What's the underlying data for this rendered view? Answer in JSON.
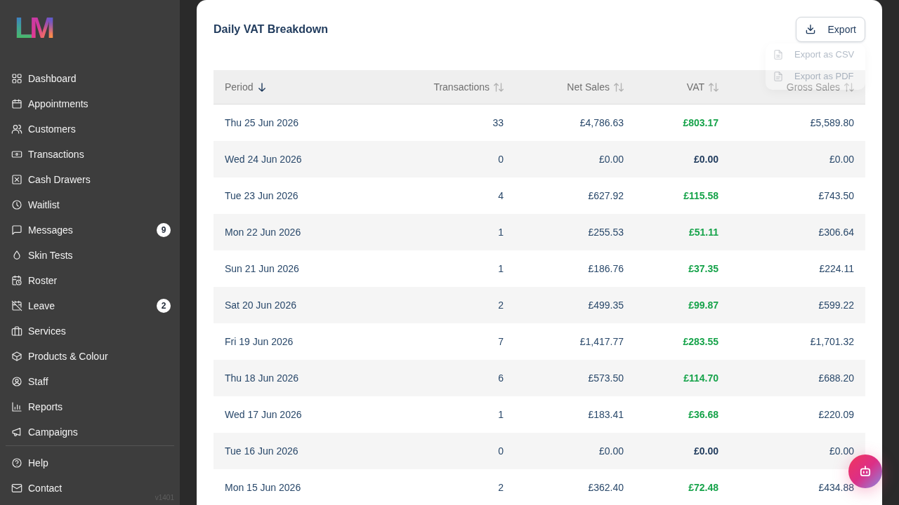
{
  "sidebar": {
    "logo_text": "LM",
    "nav_items": [
      {
        "label": "Dashboard",
        "selected": false
      },
      {
        "label": "Appointments",
        "selected": false
      },
      {
        "label": "Customers",
        "selected": false
      },
      {
        "label": "Transactions",
        "selected": false
      },
      {
        "label": "Cash Drawers",
        "selected": false
      },
      {
        "label": "Waitlist",
        "selected": false
      },
      {
        "label": "Messages",
        "selected": false,
        "badge": "9"
      },
      {
        "label": "Skin Tests",
        "selected": false
      },
      {
        "label": "Roster",
        "selected": false
      },
      {
        "label": "Leave",
        "selected": false,
        "badge": "2"
      },
      {
        "label": "Services",
        "selected": false
      },
      {
        "label": "Products & Colour",
        "selected": false
      },
      {
        "label": "Staff",
        "selected": false
      },
      {
        "label": "Reports",
        "selected": false
      },
      {
        "label": "Campaigns",
        "selected": false
      }
    ],
    "footer_items": [
      {
        "label": "Help",
        "selected": false
      },
      {
        "label": "Contact",
        "selected": false
      }
    ],
    "version": "v1401"
  },
  "report": {
    "title": "Daily VAT Breakdown",
    "export_button": {
      "label": "Export",
      "expanded": true
    },
    "export_menu": [
      "Export as CSV",
      "Export as PDF"
    ],
    "table": {
      "columns": [
        {
          "label": "Period",
          "sorted": true
        },
        {
          "label": "Transactions",
          "sorted": false
        },
        {
          "label": "Net Sales",
          "sorted": false
        },
        {
          "label": "VAT",
          "sorted": false
        },
        {
          "label": "Gross Sales",
          "sorted": false
        }
      ],
      "rows": [
        {
          "period": "Thu 25 Jun 2026",
          "transactions": "33",
          "net_sales": "£4,786.63",
          "vat": "£803.17",
          "vat_positive": true,
          "gross_sales": "£5,589.80"
        },
        {
          "period": "Wed 24 Jun 2026",
          "transactions": "0",
          "net_sales": "£0.00",
          "vat": "£0.00",
          "vat_positive": false,
          "gross_sales": "£0.00"
        },
        {
          "period": "Tue 23 Jun 2026",
          "transactions": "4",
          "net_sales": "£627.92",
          "vat": "£115.58",
          "vat_positive": true,
          "gross_sales": "£743.50"
        },
        {
          "period": "Mon 22 Jun 2026",
          "transactions": "1",
          "net_sales": "£255.53",
          "vat": "£51.11",
          "vat_positive": true,
          "gross_sales": "£306.64"
        },
        {
          "period": "Sun 21 Jun 2026",
          "transactions": "1",
          "net_sales": "£186.76",
          "vat": "£37.35",
          "vat_positive": true,
          "gross_sales": "£224.11"
        },
        {
          "period": "Sat 20 Jun 2026",
          "transactions": "2",
          "net_sales": "£499.35",
          "vat": "£99.87",
          "vat_positive": true,
          "gross_sales": "£599.22"
        },
        {
          "period": "Fri 19 Jun 2026",
          "transactions": "7",
          "net_sales": "£1,417.77",
          "vat": "£283.55",
          "vat_positive": true,
          "gross_sales": "£1,701.32"
        },
        {
          "period": "Thu 18 Jun 2026",
          "transactions": "6",
          "net_sales": "£573.50",
          "vat": "£114.70",
          "vat_positive": true,
          "gross_sales": "£688.20"
        },
        {
          "period": "Wed 17 Jun 2026",
          "transactions": "1",
          "net_sales": "£183.41",
          "vat": "£36.68",
          "vat_positive": true,
          "gross_sales": "£220.09"
        },
        {
          "period": "Tue 16 Jun 2026",
          "transactions": "0",
          "net_sales": "£0.00",
          "vat": "£0.00",
          "vat_positive": false,
          "gross_sales": "£0.00"
        },
        {
          "period": "Mon 15 Jun 2026",
          "transactions": "2",
          "net_sales": "£362.40",
          "vat": "£72.48",
          "vat_positive": true,
          "gross_sales": "£434.88"
        }
      ]
    }
  }
}
